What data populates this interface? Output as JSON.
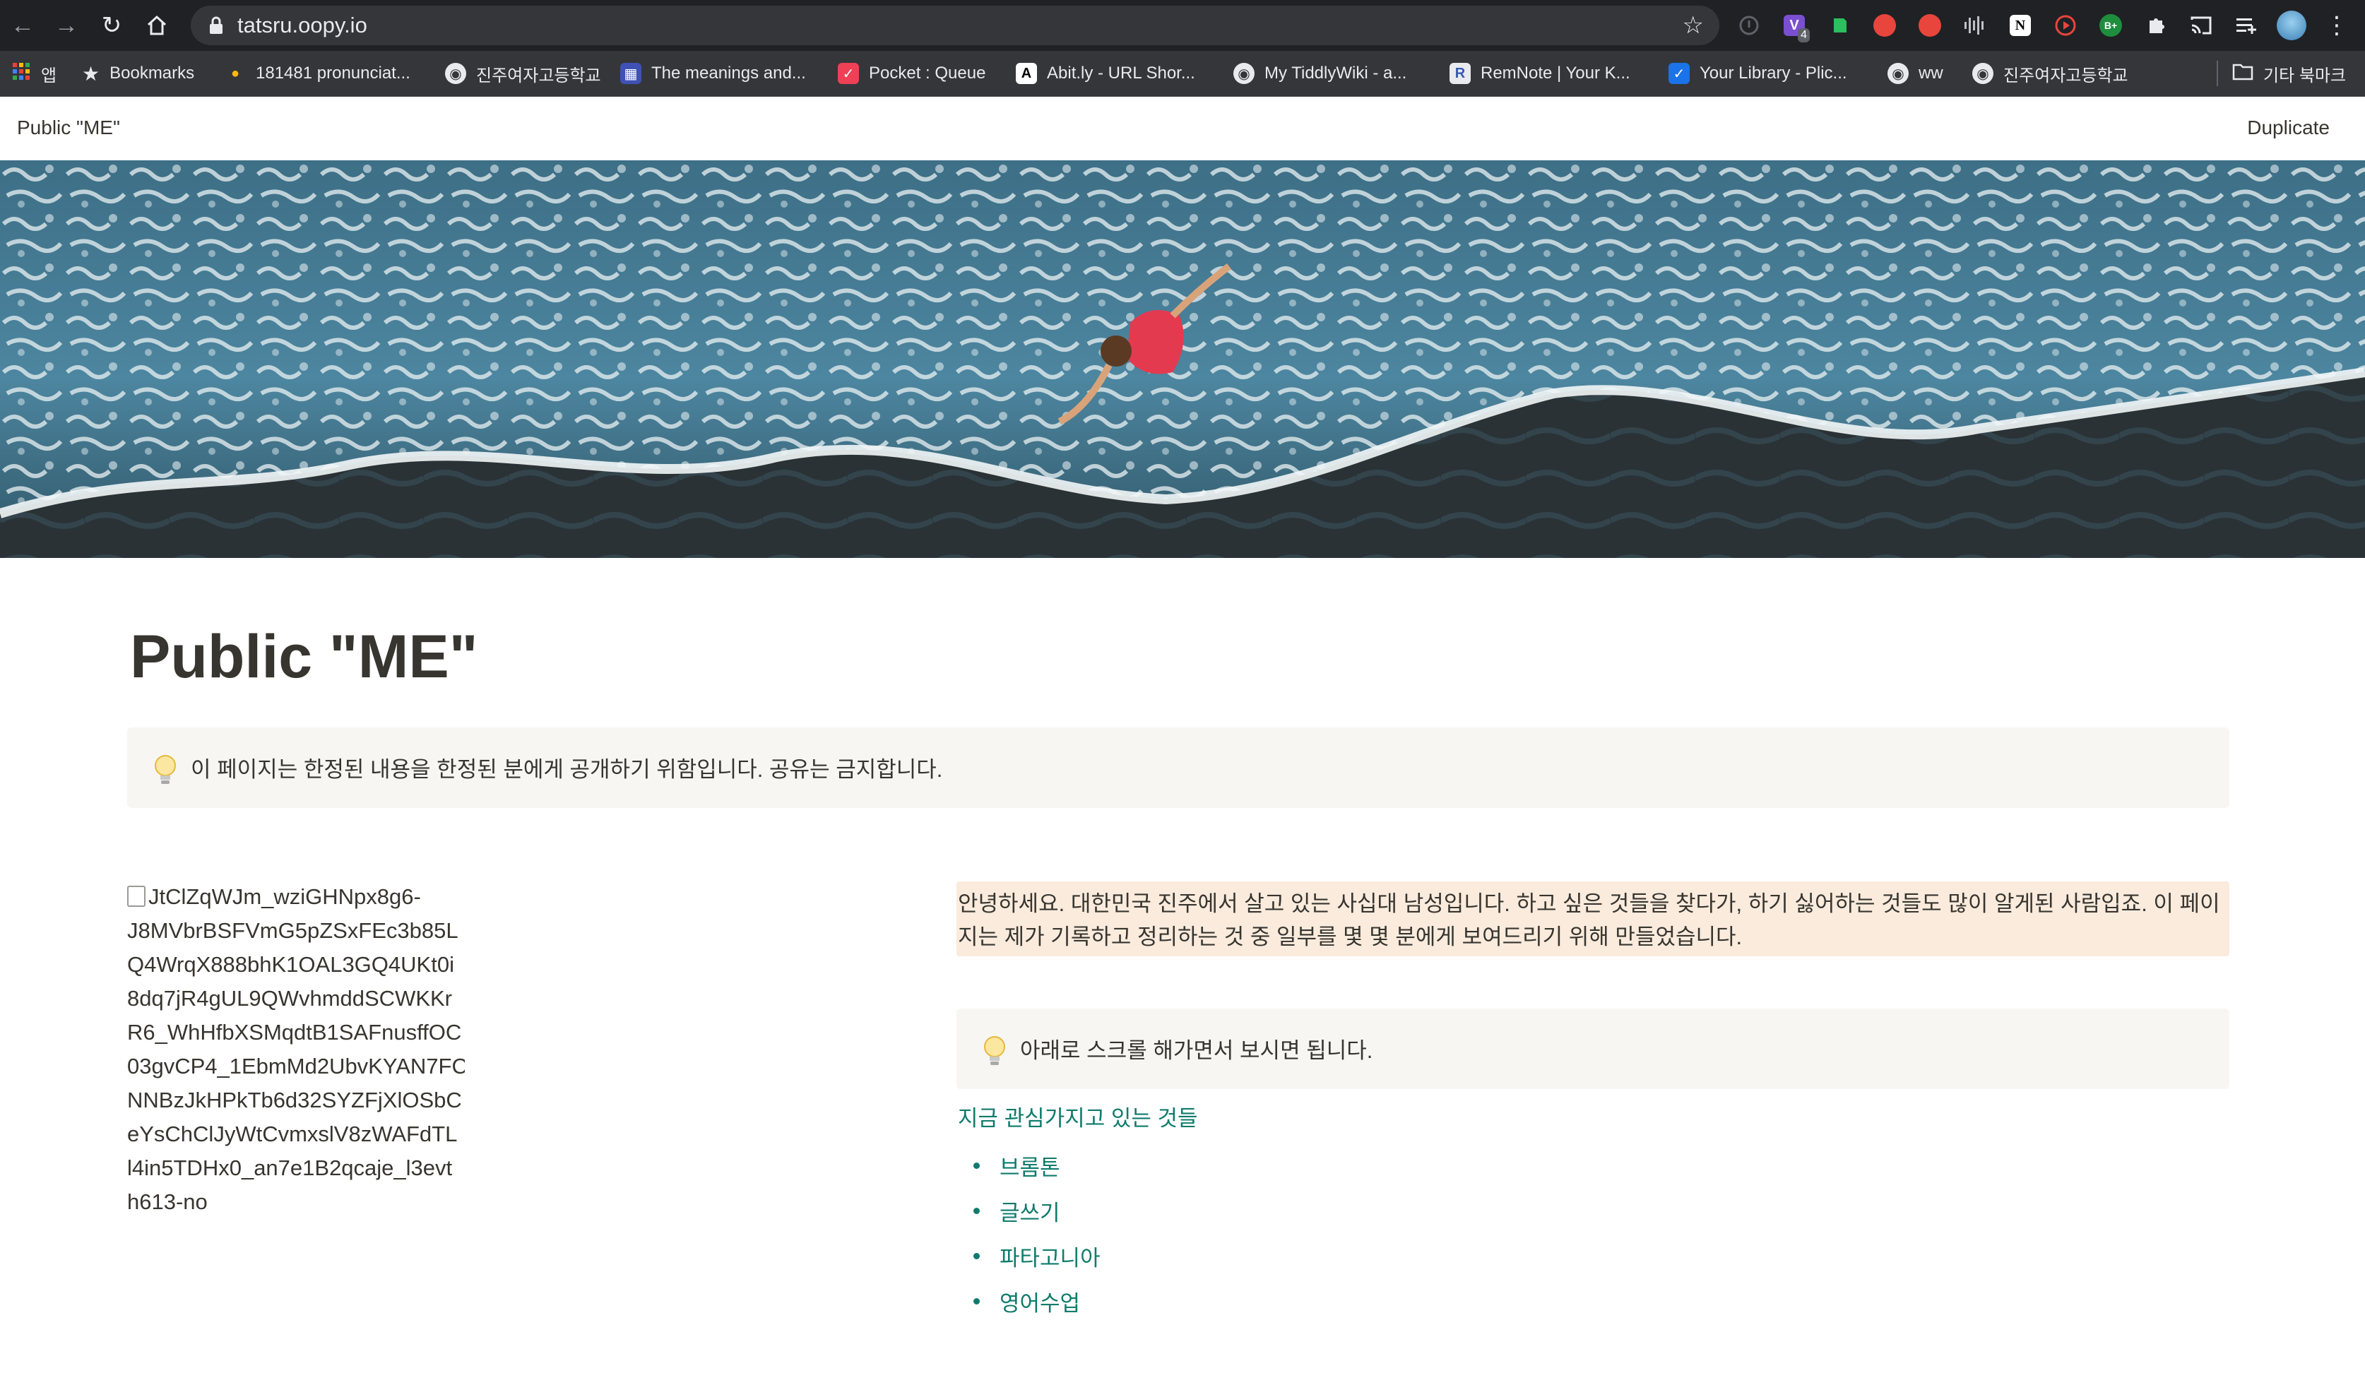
{
  "browser": {
    "url": "tatsru.oopy.io",
    "extensions": [
      {
        "name": "extension-1",
        "color": "#5f6368"
      },
      {
        "name": "extension-vimium",
        "color": "#7b4fd1",
        "badge": "4"
      },
      {
        "name": "extension-evernote",
        "color": "#2dbe60"
      },
      {
        "name": "extension-red-1",
        "color": "#e8453c"
      },
      {
        "name": "extension-red-2",
        "color": "#e8453c"
      },
      {
        "name": "extension-audio",
        "color": "#bdc1c6"
      },
      {
        "name": "extension-notion",
        "color": "#ffffff"
      },
      {
        "name": "extension-player",
        "color": "#e8453c"
      },
      {
        "name": "extension-green",
        "color": "#1e8e3e",
        "label": "B+"
      }
    ]
  },
  "bookmarks": {
    "apps_label": "앱",
    "items": [
      {
        "label": "Bookmarks"
      },
      {
        "label": "181481 pronunciat..."
      },
      {
        "label": "진주여자고등학교"
      },
      {
        "label": "The meanings and..."
      },
      {
        "label": "Pocket : Queue"
      },
      {
        "label": "Abit.ly - URL Shor..."
      },
      {
        "label": "My TiddlyWiki - a..."
      },
      {
        "label": "RemNote | Your K..."
      },
      {
        "label": "Your Library - Plic..."
      },
      {
        "label": "ww"
      },
      {
        "label": "진주여자고등학교"
      }
    ],
    "other_label": "기타 북마크"
  },
  "topbar": {
    "title": "Public \"ME\"",
    "duplicate": "Duplicate"
  },
  "page": {
    "title": "Public \"ME\"",
    "callout_text": "이 페이지는 한정된 내용을 한정된 분에게 공개하기 위함입니다. 공유는 금지합니다.",
    "broken_image_alt": "JtClZqWJm_wziGHNpx8g6-\nJ8MVbrBSFVmG5pZSxFEc3b85L\nQ4WrqX888bhK1OAL3GQ4UKt0i\n8dq7jR4gUL9QWvhmddSCWKKr\nR6_WhHfbXSMqdtB1SAFnusffOC\n03gvCP4_1EbmMd2UbvKYAN7FC\nNNBzJkHPkTb6d32SYZFjXlOSbC\neYsChClJyWtCvmxslV8zWAFdTL\nl4in5TDHx0_an7e1B2qcaje_l3evt\nh613-no",
    "intro_text": "안녕하세요. 대한민국 진주에서 살고 있는 사십대 남성입니다.  하고 싶은 것들을 찾다가, 하기 싫어하는 것들도 많이 알게된 사람입죠. 이 페이지는 제가 기록하고 정리하는 것 중 일부를 몇 몇 분에게 보여드리기 위해 만들었습니다.",
    "callout2_text": "아래로 스크롤 해가면서 보시면 됩니다.",
    "section_title": "지금 관심가지고 있는 것들",
    "interests": [
      {
        "label": "브롬톤"
      },
      {
        "label": "글쓰기"
      },
      {
        "label": "파타고니아"
      },
      {
        "label": "영어수업"
      }
    ]
  },
  "colors": {
    "accent_green": "#0f7b6c",
    "intro_highlight": "#faebdd",
    "callout_bg": "#f7f6f3"
  }
}
